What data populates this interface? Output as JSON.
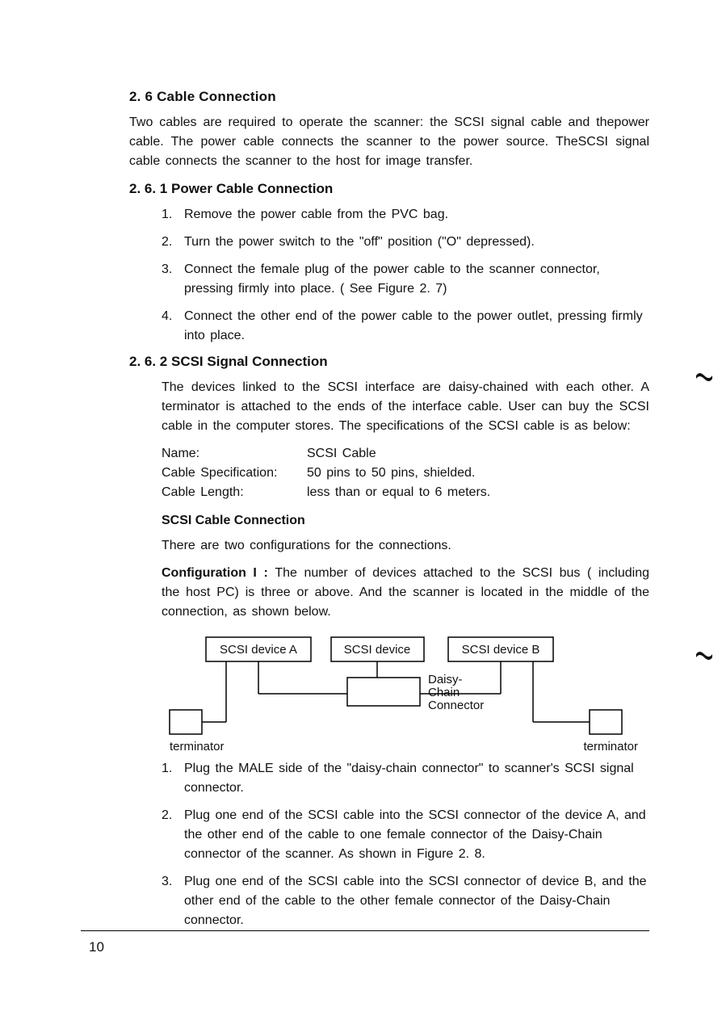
{
  "section": {
    "heading": "2. 6  Cable  Connection",
    "intro": "Two cables are required to operate the scanner: the SCSI signal cable and thepower cable. The power cable connects the scanner to the power source. TheSCSI signal cable connects the scanner to the host for image transfer."
  },
  "powerCable": {
    "heading": "2. 6. 1   Power  Cable  Connection",
    "steps": [
      "Remove the power cable from the PVC bag.",
      "Turn the power switch to the \"off\" position (\"O\" depressed).",
      "Connect the female plug of the power cable to the scanner connector, pressing firmly into place. ( See Figure 2. 7)",
      "Connect  the  other  end of the power  cable to the  power  outlet, pressing  firmly into place."
    ]
  },
  "scsi": {
    "heading": "2. 6. 2   SCSI  Signal  Connection",
    "intro": "The devices  linked to the SCSI  interface are daisy-chained  with each other.  A terminator is attached to the ends of the interface cable.  User can buy  the SCSI  cable in the  computer stores.  The specifications of the SCSI cable is as below:",
    "specs": {
      "nameLabel": "Name:",
      "nameValue": "SCSI Cable",
      "cableSpecLabel": "Cable Specification:",
      "cableSpecValue": "50 pins to 50 pins,  shielded.",
      "cableLenLabel": "Cable Length:",
      "cableLenValue": "less than or equal to 6 meters."
    },
    "connHeading": "SCSI Cable  Connection",
    "connPara": "There are two configurations for the connections.",
    "config1Label": "Configuration I : ",
    "config1Text": "The number of devices  attached  to  the  SCSI  bus ( including the host PC) is three or above. And the scanner is located in the middle of the connection,  as shown below.",
    "diagram": {
      "boxA": "SCSI device  A",
      "boxMid": "SCSI device",
      "boxB": "SCSI device B",
      "daisy": "Daisy-\nChain\nConnector",
      "termLeft": "terminator",
      "termRight": "terminator"
    },
    "config1Steps": [
      "Plug the  MALE  side of the  \"daisy-chain connector\" to scanner's SCSI signal connector.",
      "Plug one end of the SCSI cable into the SCSI connector of the device A,  and the  other end of the cable to one female  connector of the Daisy-Chain connector of the scanner.  As shown in Figure 2. 8.",
      "Plug one end of the SCSI cable into the SCSI connector of device B, and the other end of the cable to the other female connector of the Daisy-Chain connector."
    ]
  },
  "pageNumber": "10"
}
